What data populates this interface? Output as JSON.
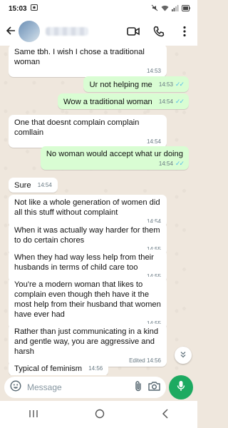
{
  "status_bar": {
    "time": "15:03",
    "left_icons": [
      "screenshot-icon"
    ],
    "right_icons": [
      "mute-icon",
      "wifi-icon",
      "signal-icon",
      "battery-icon"
    ]
  },
  "header": {
    "icons": [
      "back-arrow-icon",
      "video-call-icon",
      "phone-icon",
      "more-vert-icon"
    ]
  },
  "messages": [
    {
      "dir": "in",
      "text": "Same tbh. I wish I chose a traditional woman",
      "time": "14:53"
    },
    {
      "dir": "out",
      "text": "Ur not helping me",
      "time": "14:53"
    },
    {
      "dir": "out",
      "text": "Wow a traditional woman",
      "time": "14:54"
    },
    {
      "dir": "in",
      "text": "One that doesnt complain complain comllain",
      "time": "14:54"
    },
    {
      "dir": "out",
      "text": "No woman would accept what ur doing",
      "time": "14:54"
    },
    {
      "dir": "in",
      "text": "Sure",
      "time": "14:54"
    },
    {
      "dir": "in",
      "text": "Not like a whole generation of women did all this stuff without complaint",
      "time": "14:54"
    },
    {
      "dir": "in",
      "text": "When it was actually way harder for them to do certain chores",
      "time": "14:55"
    },
    {
      "dir": "in",
      "text": "When they had way less help from their husbands in terms of child care too",
      "time": "14:55"
    },
    {
      "dir": "in",
      "text": "You're a modern woman that likes to complain even though theh have it the most help from their husband that women have ever had",
      "time": "14:55"
    },
    {
      "dir": "in",
      "text": "Rather than just communicating in a kind and gentle way, you are aggressive and harsh",
      "time": "Edited 14:56"
    },
    {
      "dir": "in",
      "text": "Typical of feminism",
      "time": "14:56"
    }
  ],
  "composer": {
    "placeholder": "Message",
    "icons": [
      "emoji-icon",
      "attach-icon",
      "camera-icon",
      "mic-icon"
    ]
  },
  "colors": {
    "outgoing_bubble": "#d9fdd3",
    "incoming_bubble": "#ffffff",
    "chat_background": "#efe7dd",
    "accent_green": "#1daa61",
    "read_ticks": "#53bdeb"
  }
}
